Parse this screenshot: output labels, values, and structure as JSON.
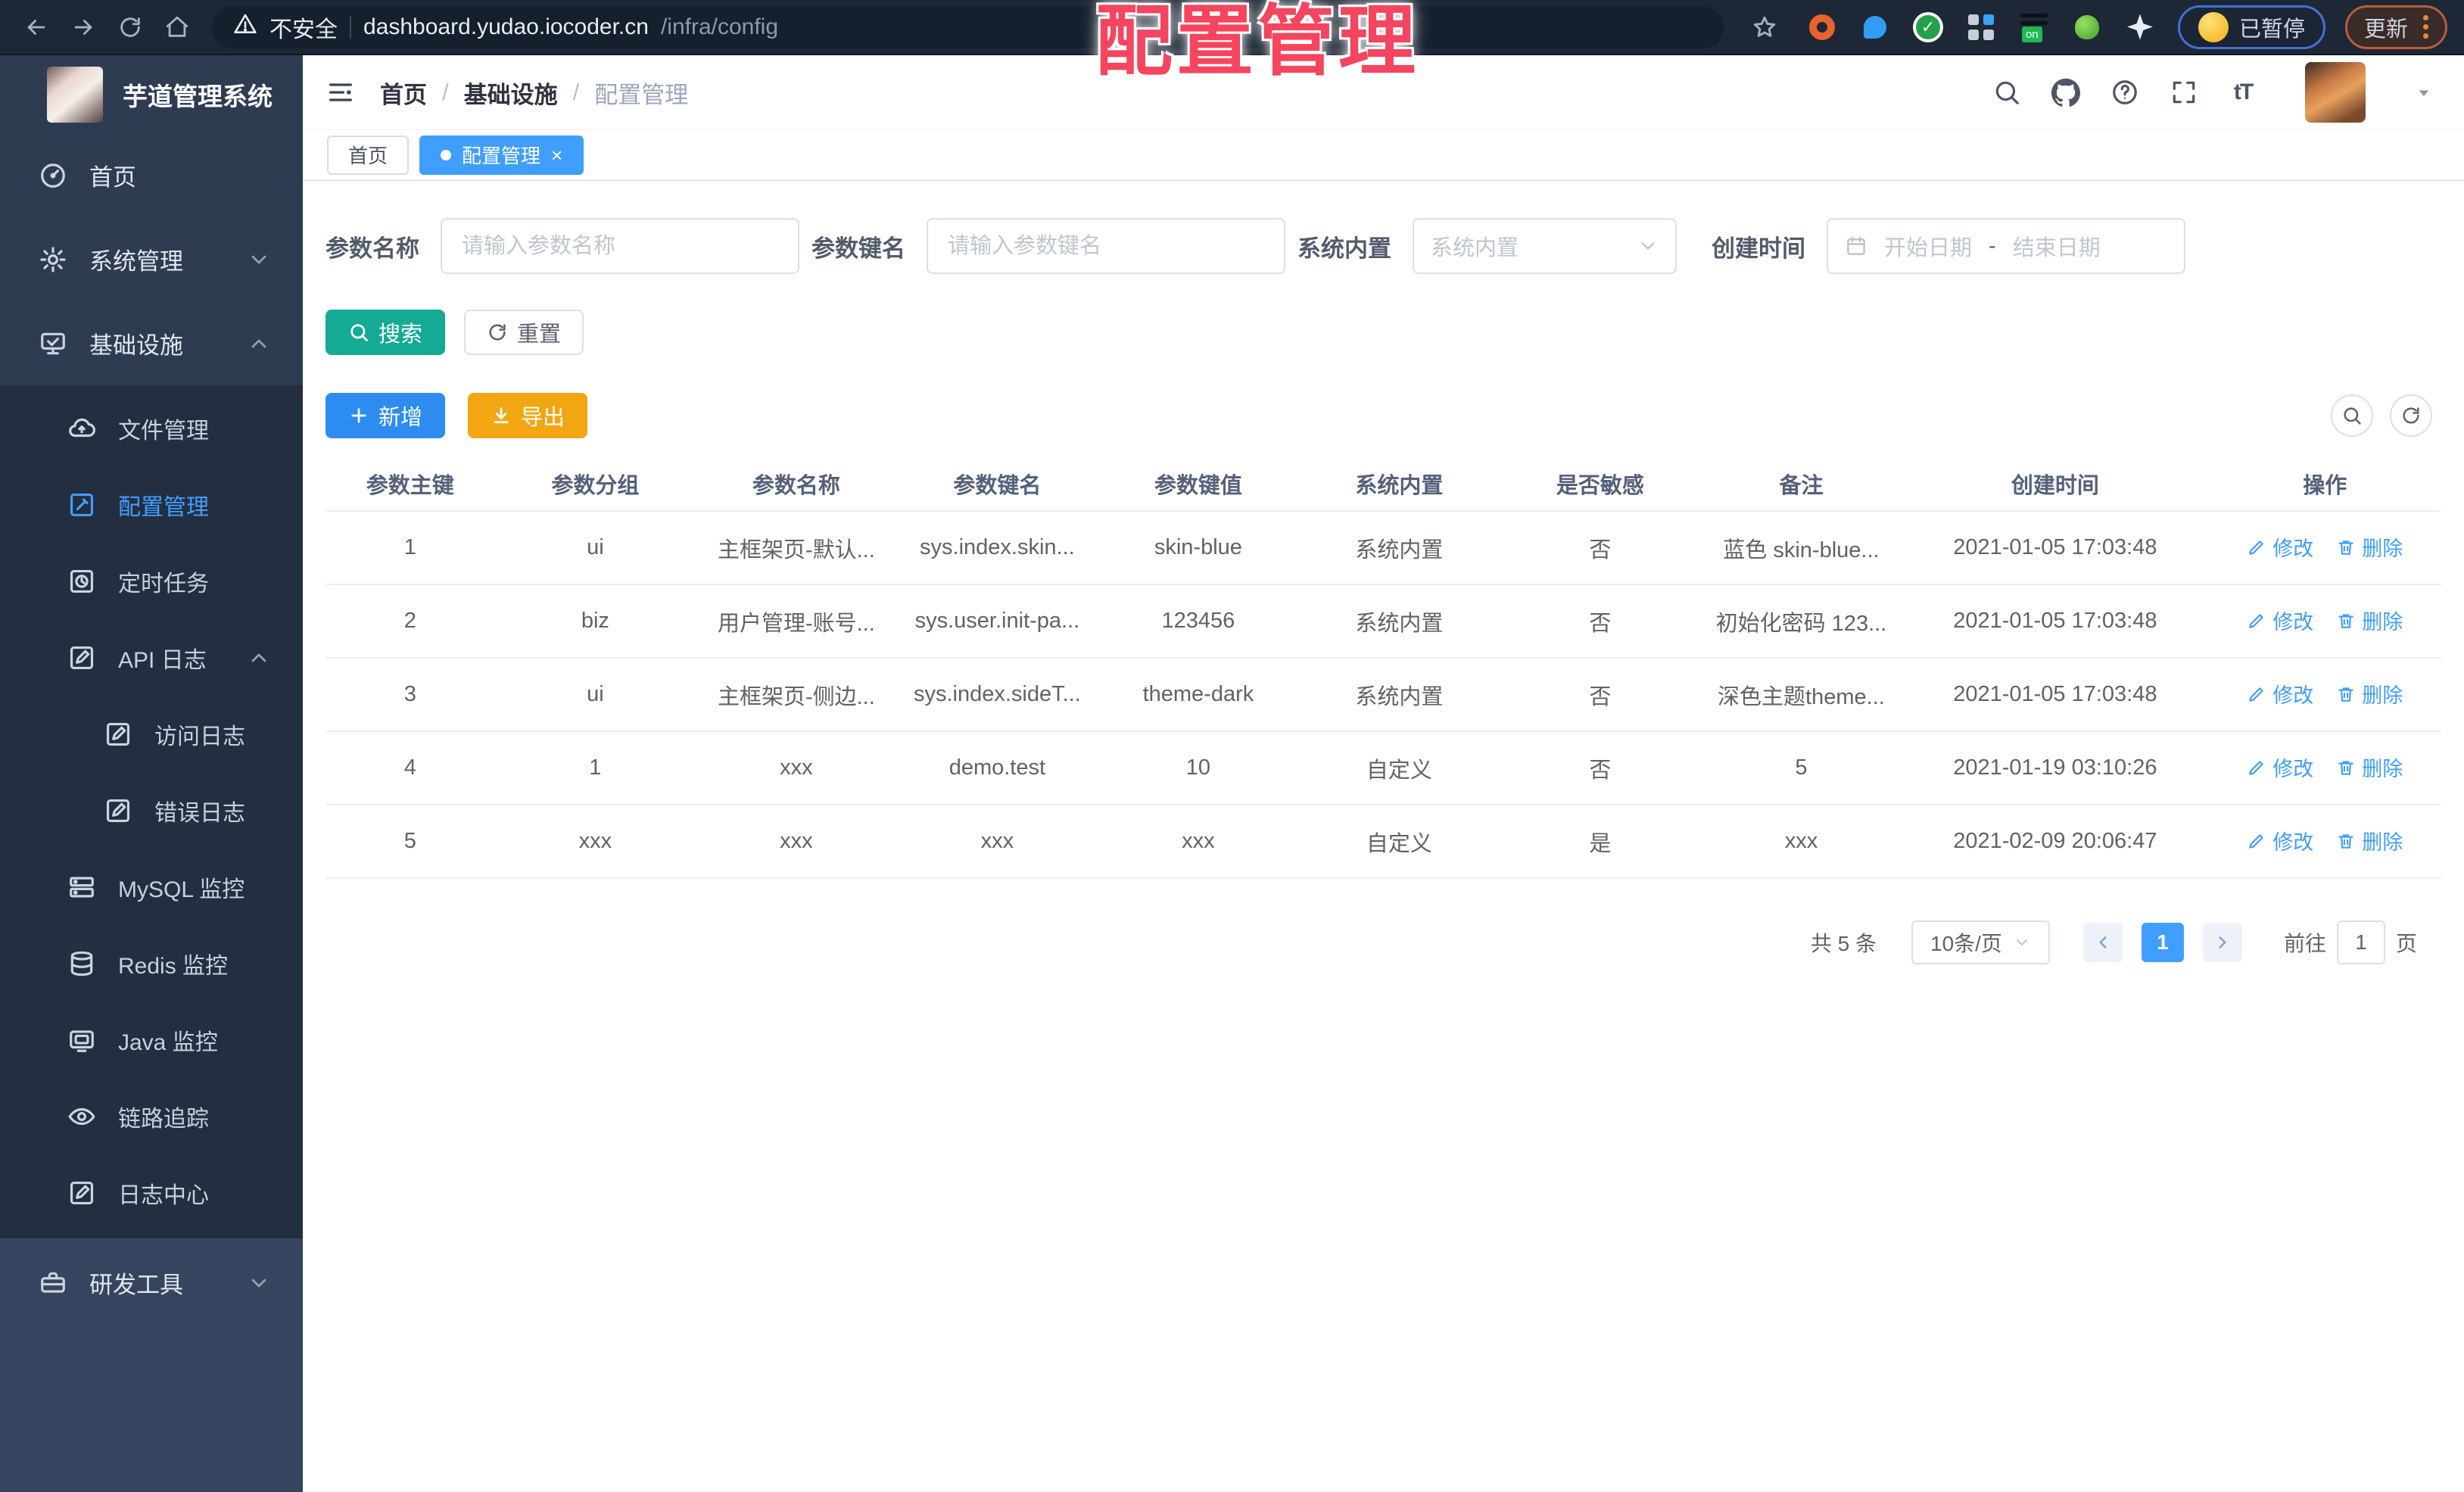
{
  "browser": {
    "security_label": "不安全",
    "url_host": "dashboard.yudao.iocoder.cn",
    "url_path": "/infra/config",
    "extension_badge": "on",
    "paused_label": "已暂停",
    "update_label": "更新"
  },
  "annotation": {
    "title": "配置管理"
  },
  "sidebar": {
    "title": "芋道管理系统",
    "items": [
      {
        "label": "首页"
      },
      {
        "label": "系统管理"
      },
      {
        "label": "基础设施"
      },
      {
        "label": "文件管理"
      },
      {
        "label": "配置管理"
      },
      {
        "label": "定时任务"
      },
      {
        "label": "API 日志"
      },
      {
        "label": "访问日志"
      },
      {
        "label": "错误日志"
      },
      {
        "label": "MySQL 监控"
      },
      {
        "label": "Redis 监控"
      },
      {
        "label": "Java 监控"
      },
      {
        "label": "链路追踪"
      },
      {
        "label": "日志中心"
      },
      {
        "label": "研发工具"
      }
    ]
  },
  "header": {
    "breadcrumb": [
      "首页",
      "基础设施",
      "配置管理"
    ]
  },
  "tabs": {
    "items": [
      {
        "label": "首页"
      },
      {
        "label": "配置管理"
      }
    ]
  },
  "filters": {
    "name_label": "参数名称",
    "name_placeholder": "请输入参数名称",
    "key_label": "参数键名",
    "key_placeholder": "请输入参数键名",
    "builtin_label": "系统内置",
    "builtin_placeholder": "系统内置",
    "date_label": "创建时间",
    "date_start_placeholder": "开始日期",
    "date_separator": "-",
    "date_end_placeholder": "结束日期",
    "search_label": "搜索",
    "reset_label": "重置"
  },
  "toolbar": {
    "add_label": "新增",
    "export_label": "导出"
  },
  "table": {
    "headers": [
      "参数主键",
      "参数分组",
      "参数名称",
      "参数键名",
      "参数键值",
      "系统内置",
      "是否敏感",
      "备注",
      "创建时间",
      "操作"
    ],
    "edit_label": "修改",
    "delete_label": "删除",
    "rows": [
      [
        "1",
        "ui",
        "主框架页-默认...",
        "sys.index.skin...",
        "skin-blue",
        "系统内置",
        "否",
        "蓝色 skin-blue...",
        "2021-01-05 17:03:48"
      ],
      [
        "2",
        "biz",
        "用户管理-账号...",
        "sys.user.init-pa...",
        "123456",
        "系统内置",
        "否",
        "初始化密码 123...",
        "2021-01-05 17:03:48"
      ],
      [
        "3",
        "ui",
        "主框架页-侧边...",
        "sys.index.sideT...",
        "theme-dark",
        "系统内置",
        "否",
        "深色主题theme...",
        "2021-01-05 17:03:48"
      ],
      [
        "4",
        "1",
        "xxx",
        "demo.test",
        "10",
        "自定义",
        "否",
        "5",
        "2021-01-19 03:10:26"
      ],
      [
        "5",
        "xxx",
        "xxx",
        "xxx",
        "xxx",
        "自定义",
        "是",
        "xxx",
        "2021-02-09 20:06:47"
      ]
    ]
  },
  "pagination": {
    "total": "共 5 条",
    "page_size": "10条/页",
    "current_page": "1",
    "goto_label": "前往",
    "goto_value": "1",
    "page_unit": "页"
  },
  "colors": {
    "accent_blue": "#409eff",
    "search_teal": "#13ab94",
    "add_blue": "#2d8cf0",
    "export_orange": "#f2a712",
    "annotation_red": "#f5455f",
    "sidebar_bg": "#2e3c52",
    "submenu_bg": "#232e40",
    "browser_bar_bg": "#1e2735"
  }
}
